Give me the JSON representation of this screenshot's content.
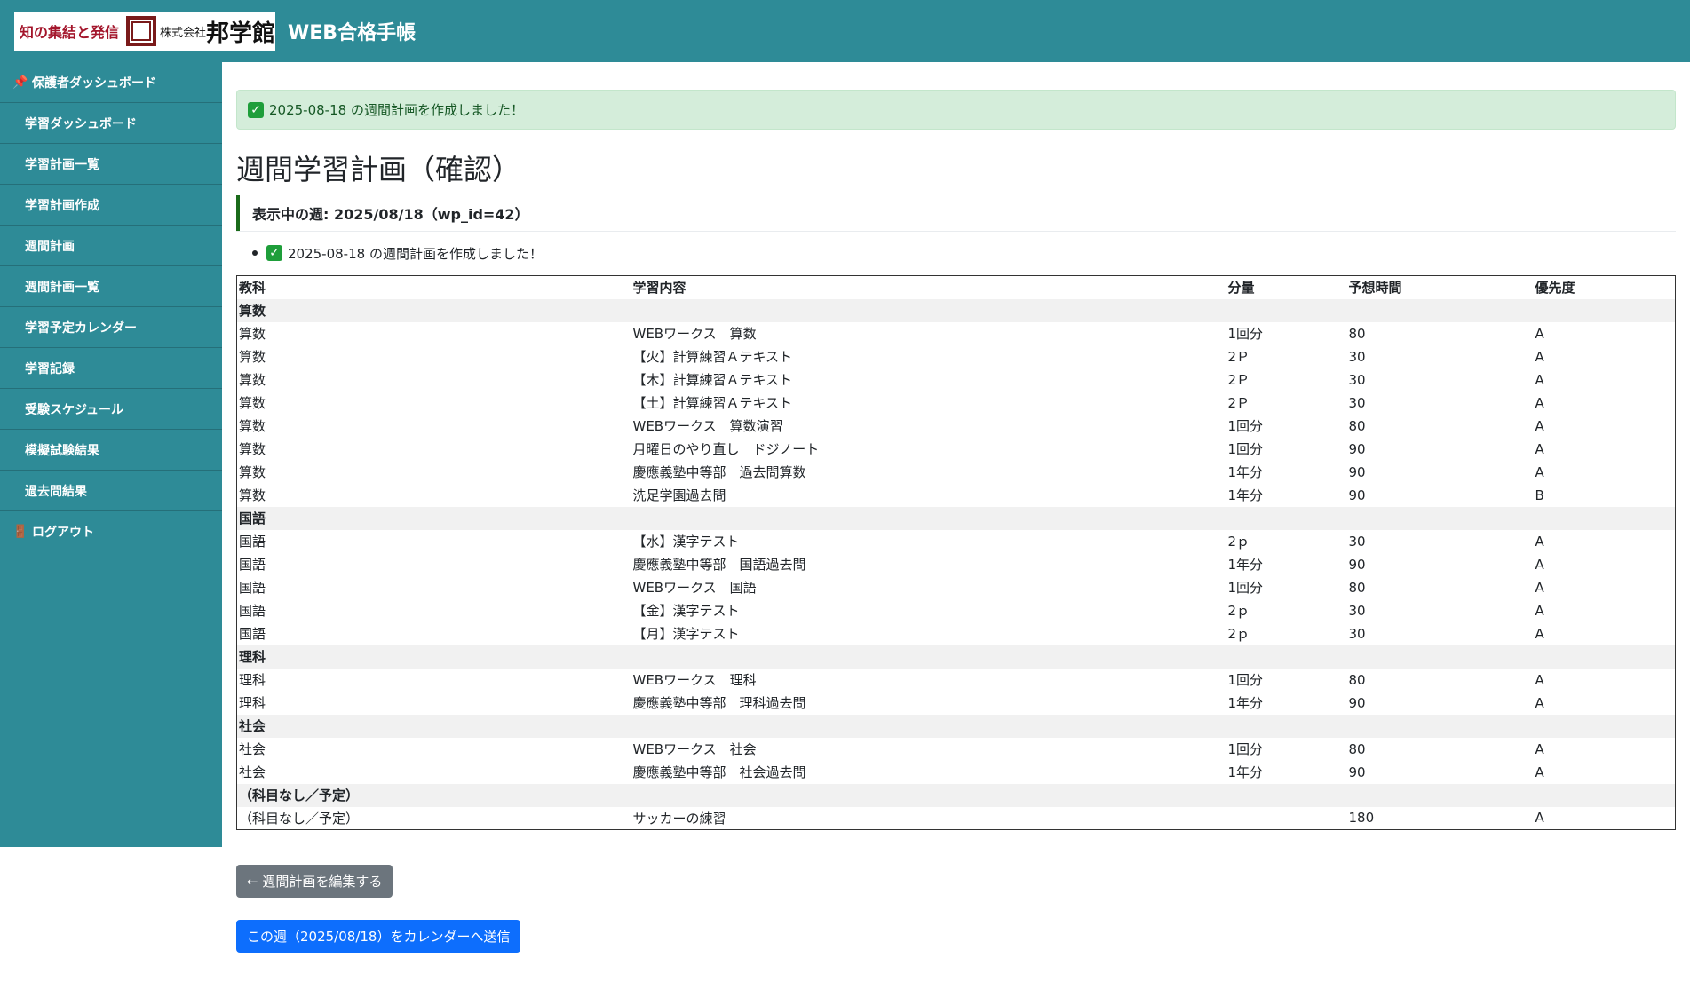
{
  "header": {
    "logo_slogan": "知の集結と発信",
    "logo_company_prefix": "株式会社",
    "logo_company_name": "邦学館",
    "app_title": "WEB合格手帳"
  },
  "sidebar": {
    "items": [
      {
        "label": "保護者ダッシュボード",
        "icon": "pushpin-icon"
      },
      {
        "label": "学習ダッシュボード"
      },
      {
        "label": "学習計画一覧"
      },
      {
        "label": "学習計画作成"
      },
      {
        "label": "週間計画"
      },
      {
        "label": "週間計画一覧"
      },
      {
        "label": "学習予定カレンダー"
      },
      {
        "label": "学習記録"
      },
      {
        "label": "受験スケジュール"
      },
      {
        "label": "模擬試験結果"
      },
      {
        "label": "過去問結果"
      },
      {
        "label": "ログアウト",
        "icon": "door-icon"
      }
    ]
  },
  "alert": {
    "text": "2025-08-18 の週間計画を作成しました！"
  },
  "page_title": "週間学習計画（確認）",
  "week_info": "表示中の週: 2025/08/18（wp_id=42）",
  "messages": [
    "2025-08-18 の週間計画を作成しました！"
  ],
  "table": {
    "headers": [
      "教科",
      "学習内容",
      "分量",
      "予想時間",
      "優先度"
    ],
    "groups": [
      {
        "name": "算数",
        "rows": [
          [
            "算数",
            "WEBワークス　算数",
            "1回分",
            "80",
            "A"
          ],
          [
            "算数",
            "【火】計算練習Ａテキスト",
            "2Ｐ",
            "30",
            "A"
          ],
          [
            "算数",
            "【木】計算練習Ａテキスト",
            "2Ｐ",
            "30",
            "A"
          ],
          [
            "算数",
            "【土】計算練習Ａテキスト",
            "2Ｐ",
            "30",
            "A"
          ],
          [
            "算数",
            "WEBワークス　算数演習",
            "1回分",
            "80",
            "A"
          ],
          [
            "算数",
            "月曜日のやり直し　ドジノート",
            "1回分",
            "90",
            "A"
          ],
          [
            "算数",
            "慶應義塾中等部　過去問算数",
            "1年分",
            "90",
            "A"
          ],
          [
            "算数",
            "洗足学園過去問",
            "1年分",
            "90",
            "B"
          ]
        ]
      },
      {
        "name": "国語",
        "rows": [
          [
            "国語",
            "【水】漢字テスト",
            "2ｐ",
            "30",
            "A"
          ],
          [
            "国語",
            "慶應義塾中等部　国語過去問",
            "1年分",
            "90",
            "A"
          ],
          [
            "国語",
            "WEBワークス　国語",
            "1回分",
            "80",
            "A"
          ],
          [
            "国語",
            "【金】漢字テスト",
            "2ｐ",
            "30",
            "A"
          ],
          [
            "国語",
            "【月】漢字テスト",
            "2ｐ",
            "30",
            "A"
          ]
        ]
      },
      {
        "name": "理科",
        "rows": [
          [
            "理科",
            "WEBワークス　理科",
            "1回分",
            "80",
            "A"
          ],
          [
            "理科",
            "慶應義塾中等部　理科過去問",
            "1年分",
            "90",
            "A"
          ]
        ]
      },
      {
        "name": "社会",
        "rows": [
          [
            "社会",
            "WEBワークス　社会",
            "1回分",
            "80",
            "A"
          ],
          [
            "社会",
            "慶應義塾中等部　社会過去問",
            "1年分",
            "90",
            "A"
          ]
        ]
      },
      {
        "name": "（科目なし／予定）",
        "rows": [
          [
            "（科目なし／予定）",
            "サッカーの練習",
            "",
            "180",
            "A"
          ]
        ]
      }
    ]
  },
  "buttons": {
    "edit": "← 週間計画を編集する",
    "send": "この週（2025/08/18）をカレンダーへ送信"
  },
  "colors": {
    "header_bg": "#2e8b97",
    "alert_bg": "#d4edda",
    "btn_secondary": "#6c757d",
    "btn_primary": "#0d6efd"
  }
}
